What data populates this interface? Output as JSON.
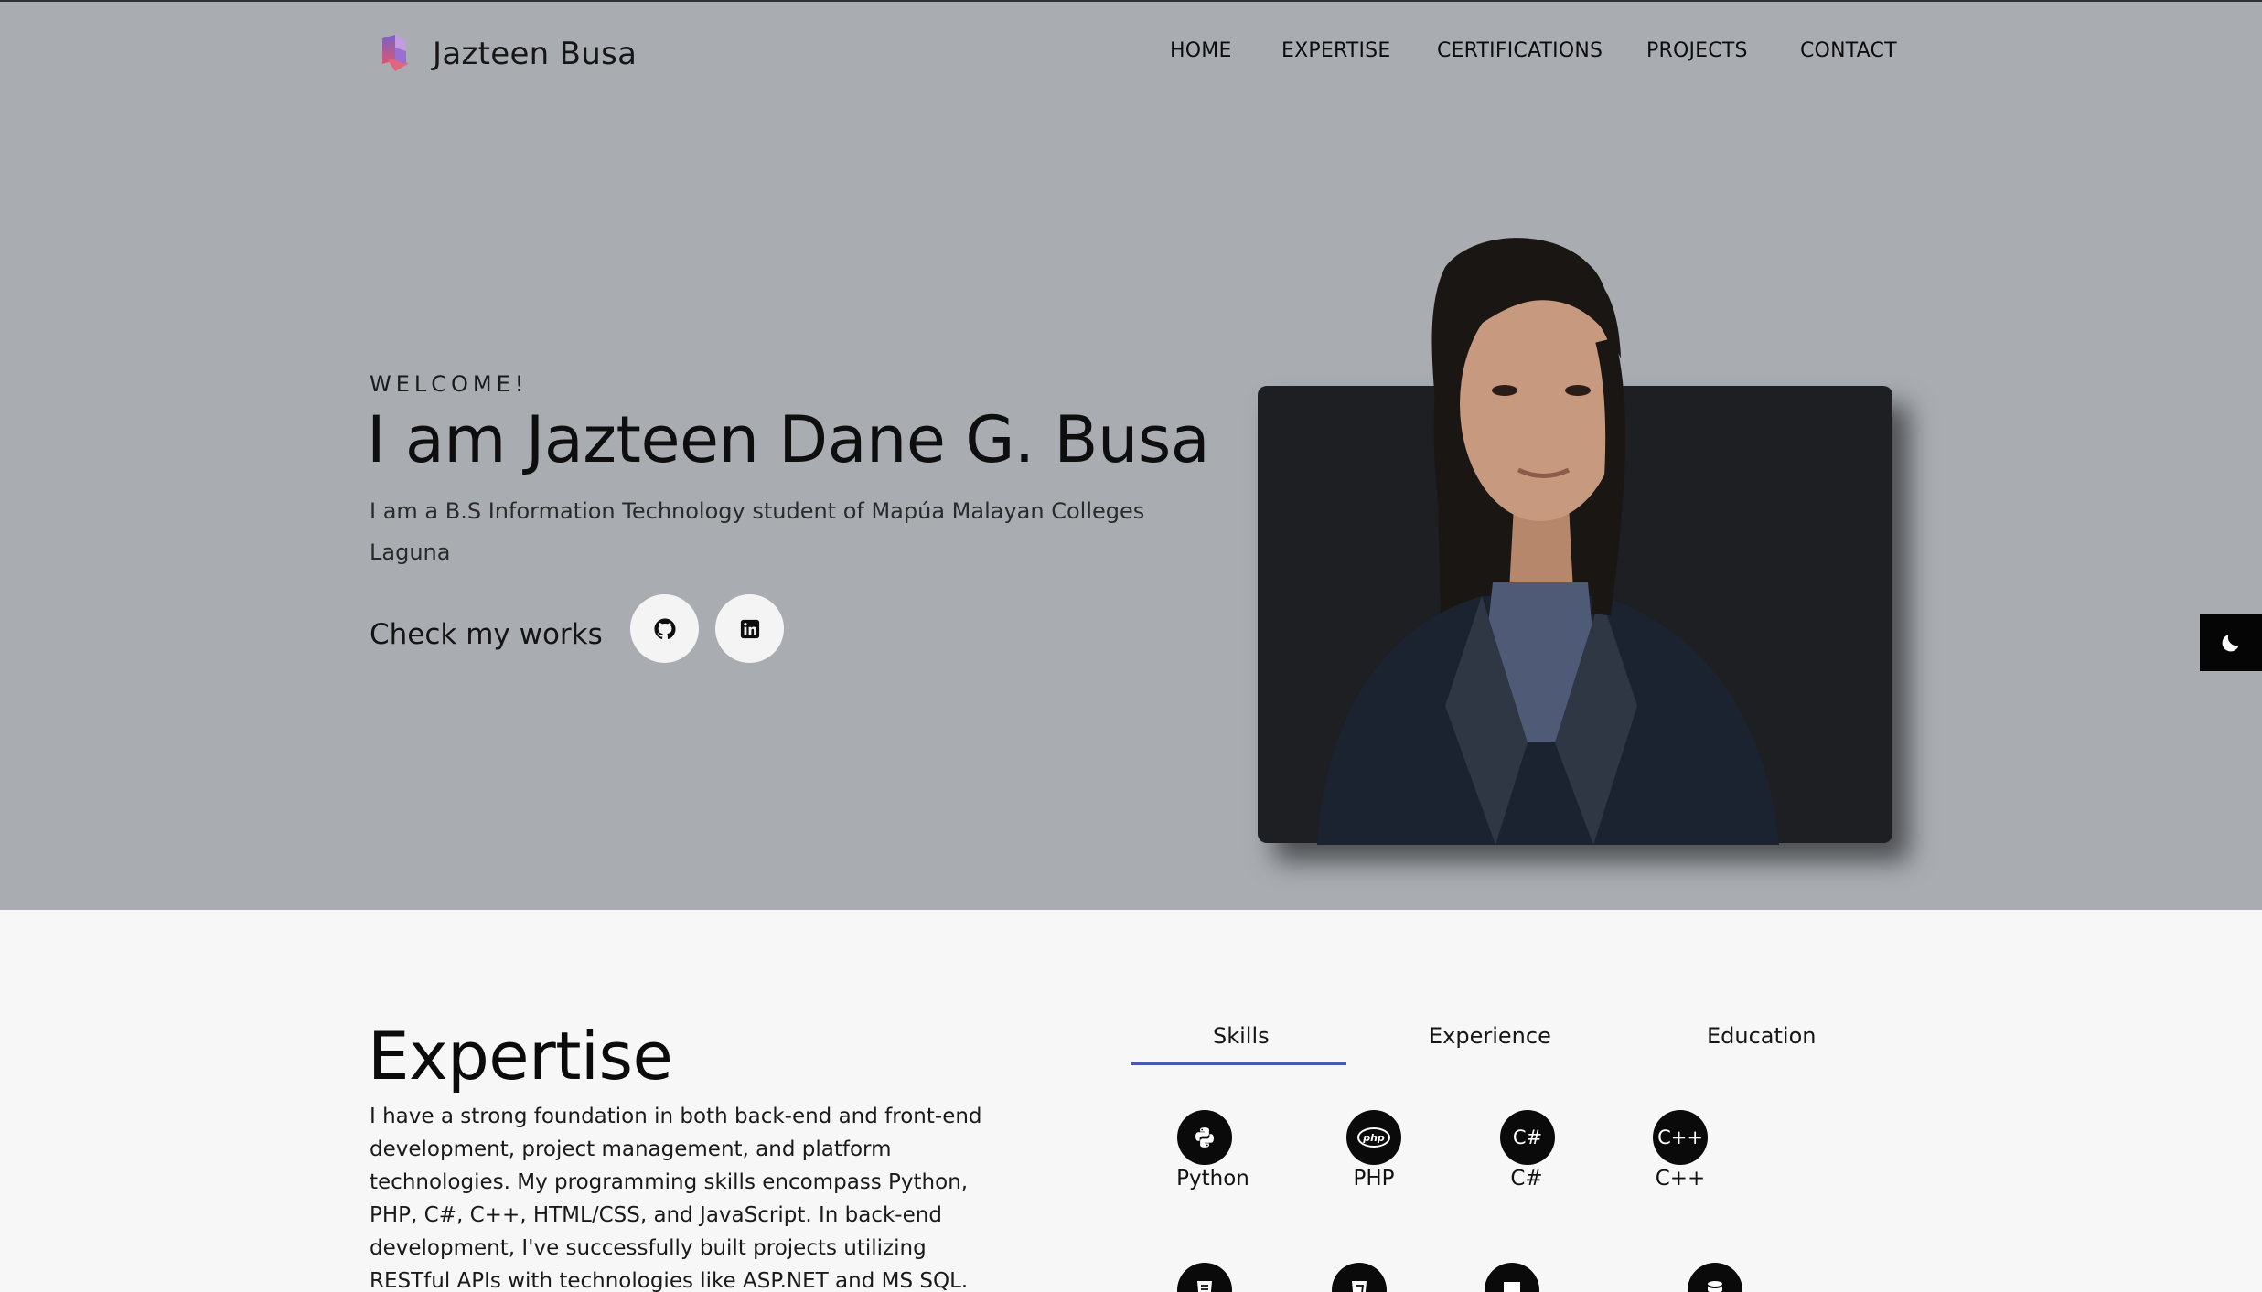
{
  "brand": {
    "name": "Jazteen Busa"
  },
  "nav": {
    "home": "HOME",
    "expertise": "EXPERTISE",
    "certifications": "CERTIFICATIONS",
    "projects": "PROJECTS",
    "contact": "CONTACT"
  },
  "hero": {
    "welcome": "WELCOME!",
    "title": "I am Jazteen Dane G. Busa",
    "description": "I am a B.S Information Technology student of Mapúa Malayan Colleges Laguna",
    "cta_label": "Check my works",
    "social": [
      "github-icon",
      "linkedin-icon"
    ]
  },
  "theme_toggle": {
    "icon": "moon-icon"
  },
  "expertise": {
    "title": "Expertise",
    "description": "I have a strong foundation in both back-end and front-end development, project management, and platform technologies. My programming skills encompass Python, PHP, C#, C++, HTML/CSS, and JavaScript. In back-end development, I've successfully built projects utilizing RESTful APIs with technologies like ASP.NET and MS SQL.",
    "tabs": [
      "Skills",
      "Experience",
      "Education"
    ],
    "active_tab": "Skills",
    "skills": [
      {
        "label": "Python",
        "icon": "python-icon",
        "glyph": ""
      },
      {
        "label": "PHP",
        "icon": "php-icon",
        "glyph": "php"
      },
      {
        "label": "C#",
        "icon": "csharp-icon",
        "glyph": "C#"
      },
      {
        "label": "C++",
        "icon": "cplusplus-icon",
        "glyph": "C++"
      }
    ],
    "more_skill_icons": [
      "html5-icon",
      "css3-icon",
      "javascript-icon",
      "database-icon"
    ]
  },
  "colors": {
    "hero_bg": "#a9adb2",
    "section_bg": "#f7f7f7",
    "accent": "#4658b4",
    "dark": "#0a0a0a"
  }
}
